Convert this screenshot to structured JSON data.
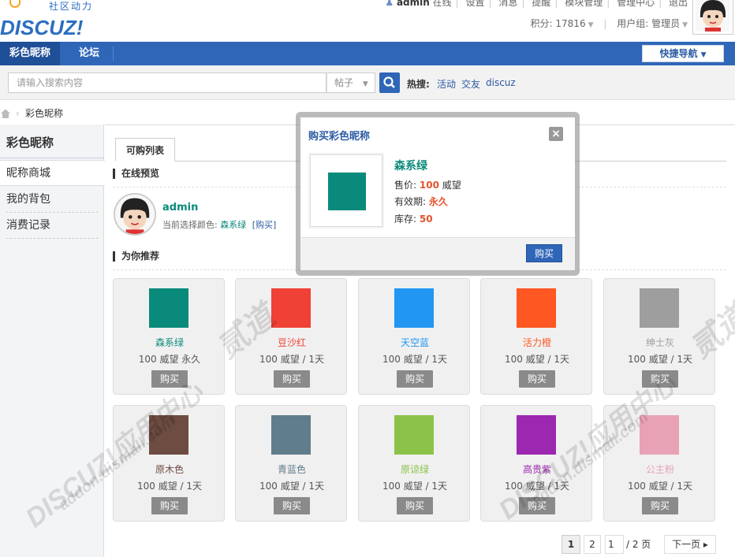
{
  "header": {
    "logo_text": "DISCUZ!",
    "logo_slogan": "社区动力",
    "username": "admin",
    "top_links": [
      "在线",
      "设置",
      "消息",
      "提醒",
      "模块管理",
      "管理中心",
      "退出"
    ],
    "credits": "积分: 17816",
    "usergroup": "用户组: 管理员"
  },
  "nav": {
    "items": [
      "彩色昵称",
      "论坛"
    ],
    "quick_nav": "快捷导航"
  },
  "search": {
    "placeholder": "请输入搜索内容",
    "type": "帖子",
    "hot_label": "热搜:",
    "hot_links": [
      "活动",
      "交友",
      "discuz"
    ]
  },
  "breadcrumb": {
    "current": "彩色昵称"
  },
  "sidebar": {
    "title": "彩色昵称",
    "items": [
      "昵称商城",
      "我的背包",
      "消费记录"
    ]
  },
  "main": {
    "tab": "可购列表",
    "preview_title": "在线预览",
    "preview_name": "admin",
    "current_prefix": "当前选择颜色:",
    "current_color": "森系绿",
    "current_buy": "[购买]",
    "recommend_title": "为你推荐"
  },
  "products": [
    {
      "name": "森系绿",
      "price": "100 威望 永久",
      "color": "#0a8a7a",
      "buy": "购买"
    },
    {
      "name": "豆沙红",
      "price": "100 威望 / 1天",
      "color": "#ef4136",
      "buy": "购买"
    },
    {
      "name": "天空蓝",
      "price": "100 威望 / 1天",
      "color": "#2196f3",
      "buy": "购买"
    },
    {
      "name": "活力橙",
      "price": "100 威望 / 1天",
      "color": "#ff5722",
      "buy": "购买"
    },
    {
      "name": "绅士灰",
      "price": "100 威望 / 1天",
      "color": "#9e9e9e",
      "buy": "购买"
    },
    {
      "name": "原木色",
      "price": "100 威望 / 1天",
      "color": "#6d4c41",
      "buy": "购买"
    },
    {
      "name": "青蓝色",
      "price": "100 威望 / 1天",
      "color": "#607d8b",
      "buy": "购买"
    },
    {
      "name": "原谅绿",
      "price": "100 威望 / 1天",
      "color": "#8bc34a",
      "buy": "购买"
    },
    {
      "name": "高贵紫",
      "price": "100 威望 / 1天",
      "color": "#9c27b0",
      "buy": "购买"
    },
    {
      "name": "公主粉",
      "price": "100 威望 / 1天",
      "color": "#e8a2b6",
      "buy": "购买"
    }
  ],
  "pagination": {
    "pages": [
      "1",
      "2"
    ],
    "current_input": "1",
    "total": "/ 2 页",
    "next": "下一页 ▸"
  },
  "modal": {
    "title": "购买彩色昵称",
    "close": "×",
    "name": "森系绿",
    "price_label": "售价:",
    "price_value": "100",
    "price_unit": "威望",
    "valid_label": "有效期:",
    "valid_value": "永久",
    "stock_label": "库存:",
    "stock_value": "50",
    "buy_button": "购买"
  },
  "watermarks": [
    "DISCUZ!应用中心",
    "addon.dismall.com",
    "贰道"
  ]
}
